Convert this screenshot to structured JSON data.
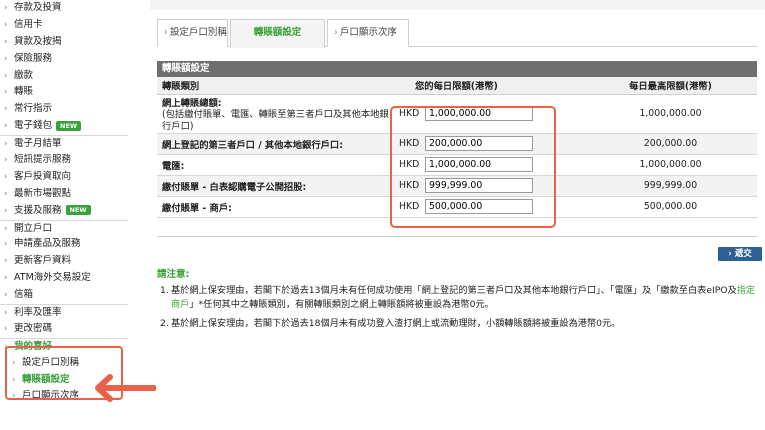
{
  "sidebar": {
    "items": [
      {
        "label": "存款及投資",
        "new": false
      },
      {
        "label": "信用卡",
        "new": false
      },
      {
        "label": "貸款及按揭",
        "new": false
      },
      {
        "label": "保險服務",
        "new": false
      },
      {
        "label": "繳款",
        "new": false
      },
      {
        "label": "轉賬",
        "new": false
      },
      {
        "label": "常行指示",
        "new": false
      },
      {
        "label": "電子錢包",
        "new": true
      },
      {
        "label": "電子月結單",
        "new": false
      },
      {
        "label": "短訊提示服務",
        "new": false
      },
      {
        "label": "客戶投資取向",
        "new": false
      },
      {
        "label": "最新市場觀點",
        "new": false
      },
      {
        "label": "支援及服務",
        "new": true
      },
      {
        "label": "開立戶口",
        "new": false
      },
      {
        "label": "申請產品及服務",
        "new": false
      },
      {
        "label": "更新客戶資料",
        "new": false
      },
      {
        "label": "ATM海外交易設定",
        "new": false
      },
      {
        "label": "信箱",
        "new": false
      },
      {
        "label": "利率及匯率",
        "new": false
      },
      {
        "label": "更改密碼",
        "new": false
      }
    ],
    "new_badge": "NEW",
    "favorites": {
      "title": "我的喜好",
      "items": [
        "設定戶口別稱",
        "轉賬額設定",
        "戶口顯示次序"
      ]
    }
  },
  "tabs": [
    {
      "label": "設定戶口別稱"
    },
    {
      "label": "轉賬額設定"
    },
    {
      "label": "戶口顯示次序"
    }
  ],
  "panel": {
    "title": "轉賬額設定",
    "headers": {
      "type": "轉賬類別",
      "daily_limit": "您的每日限額(港幣)",
      "max_limit": "每日最高限額(港幣)"
    },
    "rows": [
      {
        "label": "網上轉賬總額:",
        "note": "(包括繳付賬單、電匯、轉賬至第三者戶口及其他本地銀行戶口)",
        "currency": "HKD",
        "value": "1,000,000.00",
        "max": "1,000,000.00"
      },
      {
        "label": "網上登記的第三者戶口 / 其他本地銀行戶口:",
        "currency": "HKD",
        "value": "200,000.00",
        "max": "200,000.00"
      },
      {
        "label": "電匯:",
        "currency": "HKD",
        "value": "1,000,000.00",
        "max": "1,000,000.00"
      },
      {
        "label": "繳付賬單 - 白表認購電子公開招股:",
        "currency": "HKD",
        "value": "999,999.00",
        "max": "999,999.00"
      },
      {
        "label": "繳付賬單 - 商戶:",
        "currency": "HKD",
        "value": "500,000.00",
        "max": "500,000.00"
      }
    ]
  },
  "submit_label": "遞交",
  "notes": {
    "title": "請注意:",
    "items": [
      {
        "num": "1.",
        "text_before": "基於網上保安理由，若閣下於過去13個月未有任何成功使用「網上登記的第三者戶口及其他本地銀行戶口」、「電匯」及「繳款至白表eIPO及",
        "link": "指定商戶",
        "text_after": "」*任何其中之轉賬類別，有關轉賬類別之網上轉賬額將被重設為港幣0元。"
      },
      {
        "num": "2.",
        "text_before": "基於網上保安理由，若閣下於過去18個月未有成功登入渣打網上或流動理財，小額轉賬額將被重設為港幣0元。",
        "link": "",
        "text_after": ""
      }
    ]
  },
  "colors": {
    "accent_green": "#3aa23a",
    "highlight_red": "#e8624a",
    "button_blue": "#2c5f94",
    "panel_header": "#6f6f6f"
  }
}
